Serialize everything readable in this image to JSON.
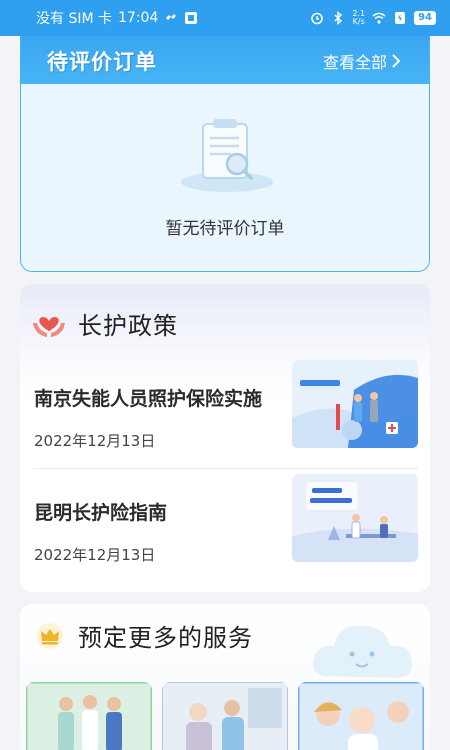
{
  "status_bar": {
    "carrier": "没有 SIM 卡",
    "time": "17:04",
    "network_speed_top": "2.1",
    "network_speed_unit": "K/s",
    "battery": "94"
  },
  "review_section": {
    "title": "待评价订单",
    "view_all": "查看全部",
    "empty_text": "暂无待评价订单"
  },
  "policy_section": {
    "title": "长护政策",
    "items": [
      {
        "title": "南京失能人员照护保险实施",
        "date": "2022年12月13日"
      },
      {
        "title": "昆明长护险指南",
        "date": "2022年12月13日"
      }
    ]
  },
  "services_section": {
    "title": "预定更多的服务"
  },
  "colors": {
    "brand_blue": "#2f9ff0",
    "card_border": "#4bb2ef",
    "heart_red": "#e8574f",
    "crown_gold": "#f0b429"
  },
  "icons": [
    "nfc-icon",
    "sim-icon",
    "alarm-icon",
    "bluetooth-icon",
    "wifi-icon",
    "charging-icon",
    "heart-hands-icon",
    "crown-icon",
    "chevron-right-icon"
  ]
}
